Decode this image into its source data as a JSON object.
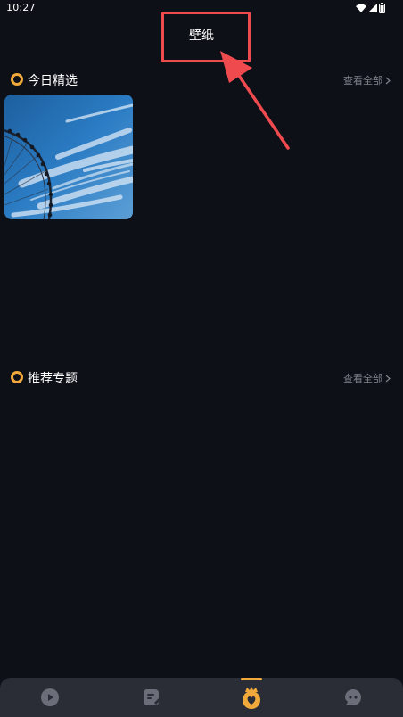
{
  "status_bar": {
    "time": "10:27",
    "icons": [
      "wifi-icon",
      "signal-icon",
      "battery-icon"
    ]
  },
  "header": {
    "title": "壁纸"
  },
  "sections": {
    "daily_picks": {
      "title": "今日精选",
      "view_all": "查看全部",
      "items": [
        {
          "image": "ferris-wheel-sky-wallpaper"
        }
      ]
    },
    "recommended_topics": {
      "title": "推荐专题",
      "view_all": "查看全部",
      "items": []
    }
  },
  "bottom_nav": {
    "items": [
      {
        "icon": "play-icon",
        "active": false
      },
      {
        "icon": "edit-note-icon",
        "active": false
      },
      {
        "icon": "heart-crown-icon",
        "active": true
      },
      {
        "icon": "chat-bubble-icon",
        "active": false
      }
    ]
  },
  "colors": {
    "background": "#0d1017",
    "accent": "#f2a93b",
    "annotation": "#ef4b4f",
    "nav_background": "#2b2d36",
    "muted_text": "#7f838b",
    "inactive_icon": "#6b6e78"
  }
}
